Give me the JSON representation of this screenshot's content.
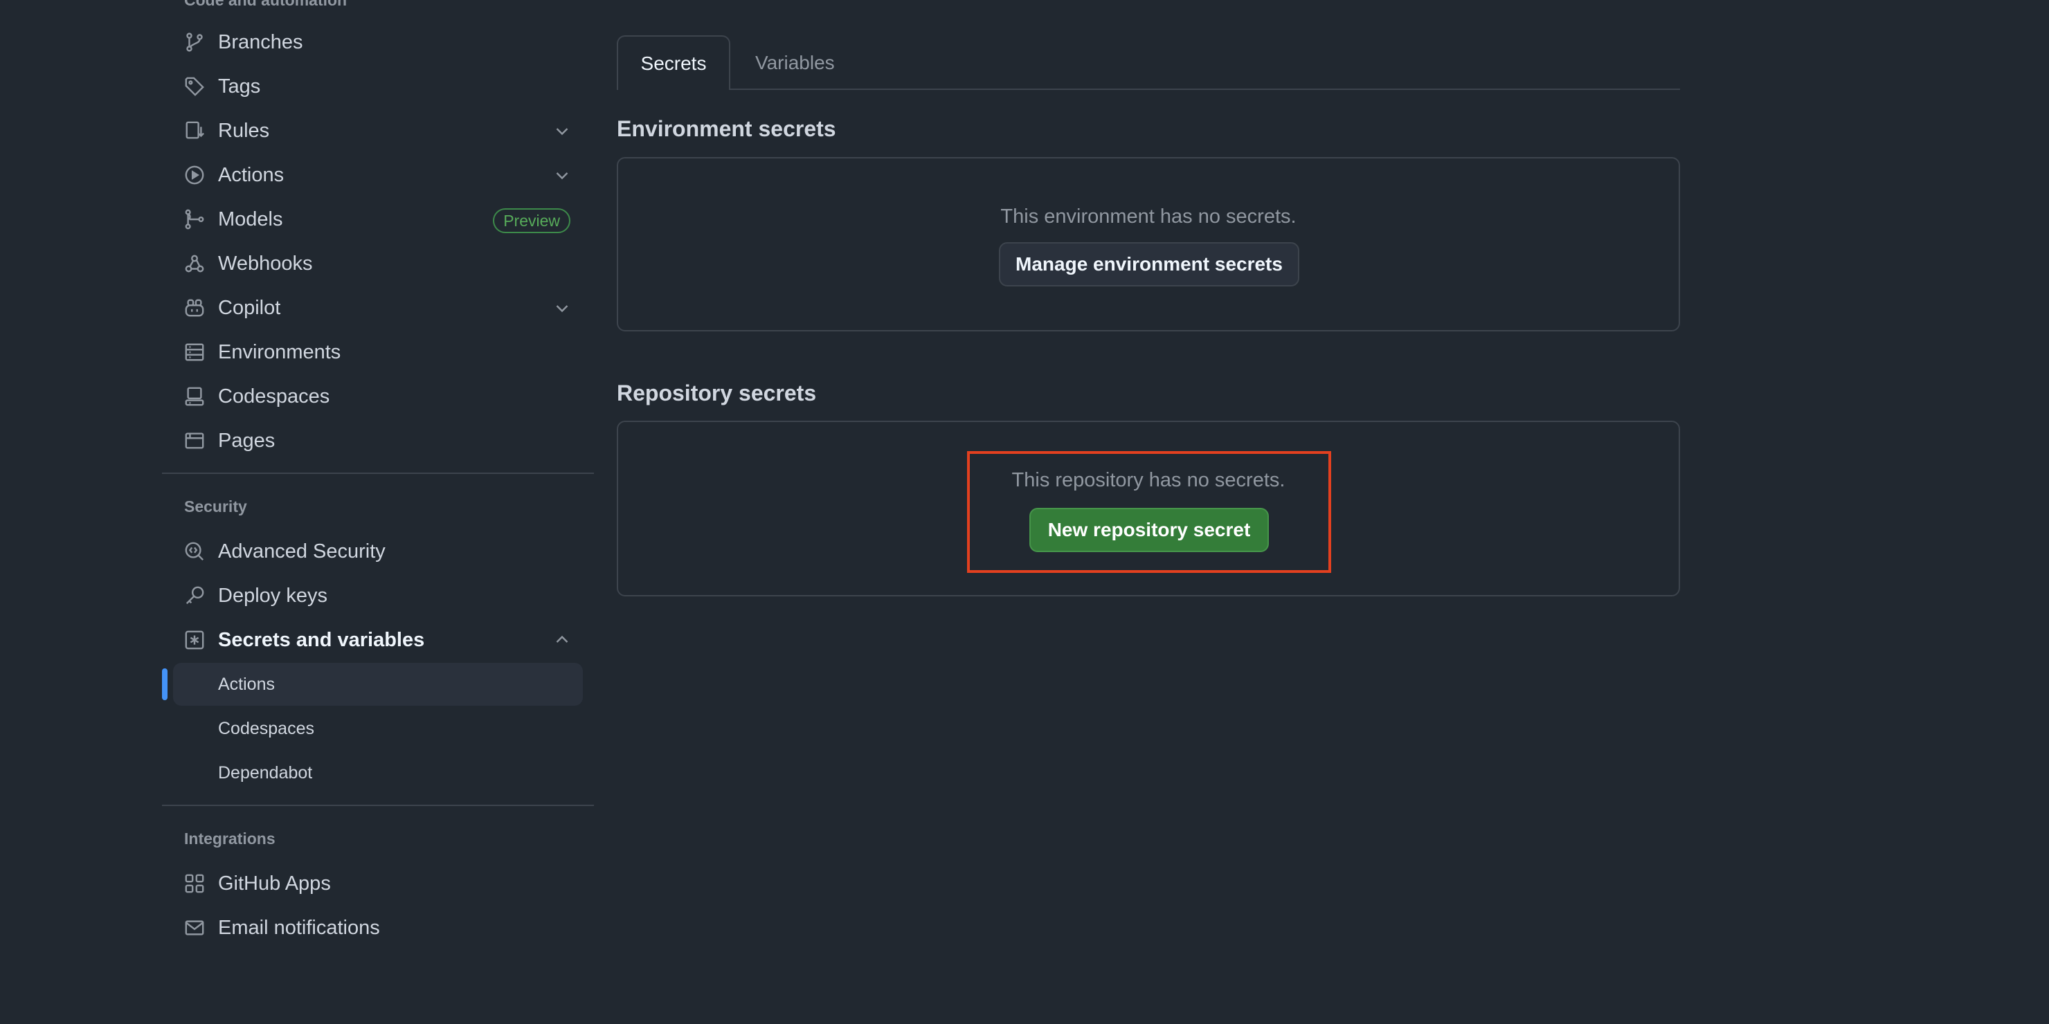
{
  "sidebar": {
    "section_code": "Code and automation",
    "items_code": [
      {
        "label": "Branches",
        "icon": "git-branch-icon"
      },
      {
        "label": "Tags",
        "icon": "tag-icon"
      },
      {
        "label": "Rules",
        "icon": "rules-icon",
        "expandable": true
      },
      {
        "label": "Actions",
        "icon": "play-icon",
        "expandable": true
      },
      {
        "label": "Models",
        "icon": "models-icon",
        "badge": "Preview"
      },
      {
        "label": "Webhooks",
        "icon": "webhook-icon"
      },
      {
        "label": "Copilot",
        "icon": "copilot-icon",
        "expandable": true
      },
      {
        "label": "Environments",
        "icon": "server-icon"
      },
      {
        "label": "Codespaces",
        "icon": "codespaces-icon"
      },
      {
        "label": "Pages",
        "icon": "browser-icon"
      }
    ],
    "section_security": "Security",
    "items_security": [
      {
        "label": "Advanced Security",
        "icon": "codescan-icon"
      },
      {
        "label": "Deploy keys",
        "icon": "key-icon"
      },
      {
        "label": "Secrets and variables",
        "icon": "key-asterisk-icon",
        "expanded": true
      }
    ],
    "sub_items": [
      {
        "label": "Actions",
        "active": true
      },
      {
        "label": "Codespaces"
      },
      {
        "label": "Dependabot"
      }
    ],
    "section_integrations": "Integrations",
    "items_integrations": [
      {
        "label": "GitHub Apps",
        "icon": "apps-icon"
      },
      {
        "label": "Email notifications",
        "icon": "mail-icon"
      }
    ]
  },
  "main": {
    "tabs": [
      {
        "label": "Secrets",
        "selected": true
      },
      {
        "label": "Variables"
      }
    ],
    "environment": {
      "heading": "Environment secrets",
      "empty_text": "This environment has no secrets.",
      "button": "Manage environment secrets"
    },
    "repository": {
      "heading": "Repository secrets",
      "empty_text": "This repository has no secrets.",
      "button": "New repository secret"
    }
  },
  "colors": {
    "background": "#212830",
    "border": "#3d444d",
    "primary_button": "#347d39",
    "active_indicator": "#4493f8",
    "highlight": "#e3401f",
    "badge": "#57ab5a"
  }
}
